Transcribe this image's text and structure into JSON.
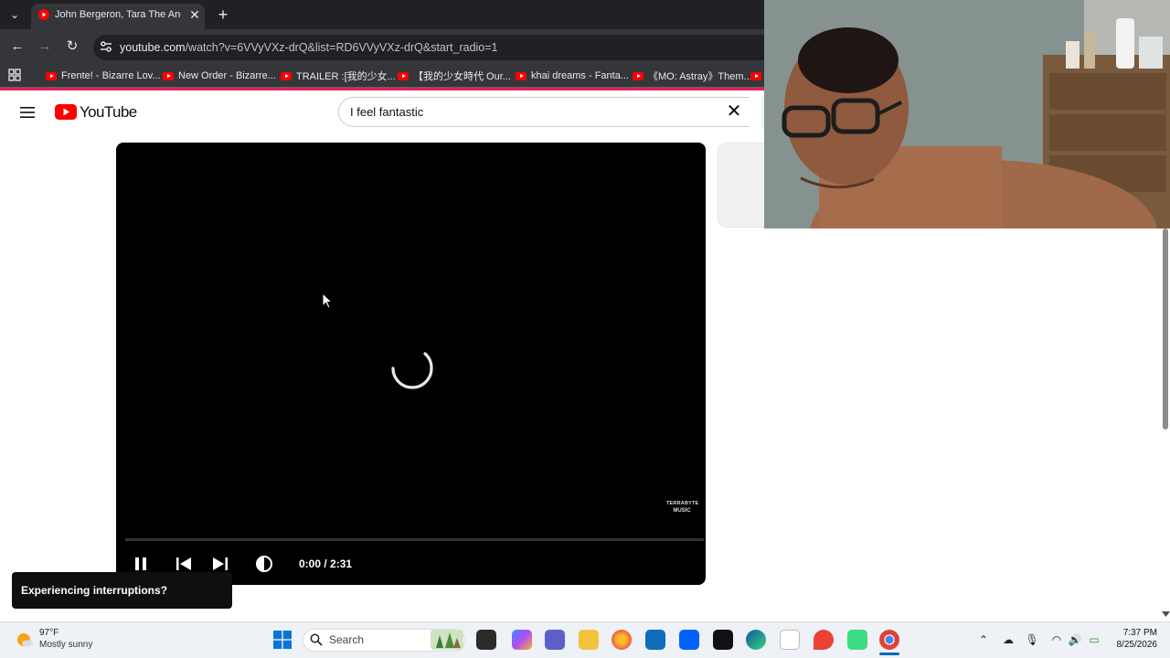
{
  "browser": {
    "tab_title": "John Bergeron, Tara The Andro",
    "url_host": "youtube.com",
    "url_rest": "/watch?v=6VVyVXz-drQ&list=RD6VVyVXz-drQ&start_radio=1",
    "bookmarks": [
      "Frente! - Bizarre Lov...",
      "New Order - Bizarre...",
      "TRAILER :[我的少女...",
      "【我的少女時代 Our...",
      "khai dreams - Fanta...",
      "《MO: Astray》Them..."
    ]
  },
  "youtube": {
    "logo_text": "YouTube",
    "search_value": "I feel fantastic",
    "player": {
      "time": "0:00 / 2:31",
      "progress": 0.0,
      "watermark_top": "TERRABYTE",
      "watermark_bottom": "MUSIC"
    },
    "toast": "Experiencing interruptions?"
  },
  "taskbar": {
    "weather_temp": "97°F",
    "weather_desc": "Mostly sunny",
    "search_label": "Search",
    "time": "7:37 PM",
    "date": "8/25/2026",
    "pinned": [
      "file-explorer",
      "copilot",
      "teams",
      "folder",
      "firefox",
      "mail",
      "dropbox",
      "notion",
      "edge",
      "notepad",
      "maps",
      "android",
      "chrome"
    ]
  },
  "colors": {
    "yt_red": "#ff0000",
    "chrome_dark": "#202124",
    "toolbar": "#35363a",
    "accent_line": "#e02055"
  }
}
